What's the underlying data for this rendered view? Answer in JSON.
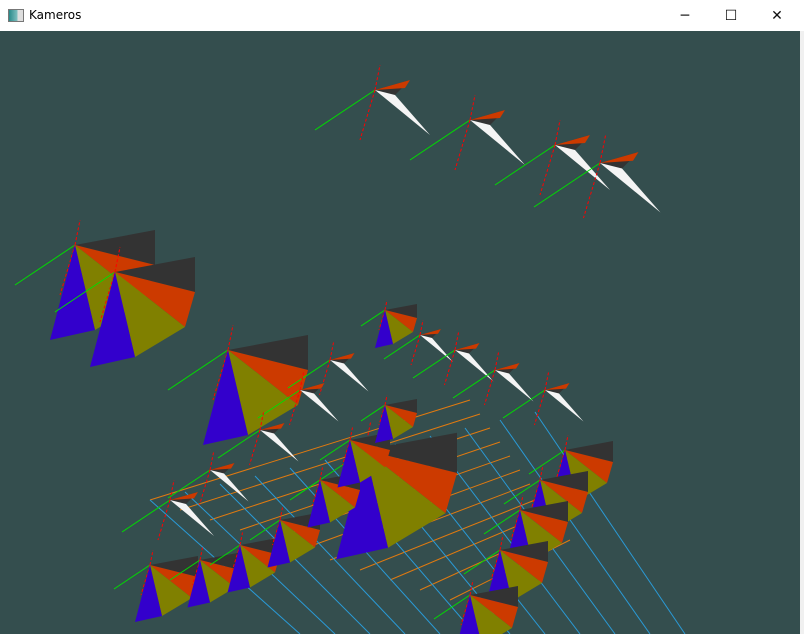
{
  "window": {
    "title": "Kameros",
    "icons": {
      "app": "app-window-icon",
      "minimize": "minimize-icon",
      "maximize": "maximize-icon",
      "close": "close-icon"
    },
    "glyphs": {
      "minimize": "─",
      "maximize": "☐",
      "close": "✕"
    }
  },
  "scene": {
    "background": "#344e4e",
    "colors": {
      "dark": "#333333",
      "orange": "#cc3a00",
      "olive": "#808000",
      "blue": "#3300cc",
      "white": "#f4f4f4",
      "grid_blue": "#2a9ad6",
      "grid_orange": "#e07a10",
      "axis_green": "#00dd00",
      "axis_red": "#ff0000",
      "axis_blue": "#0000ff"
    }
  }
}
